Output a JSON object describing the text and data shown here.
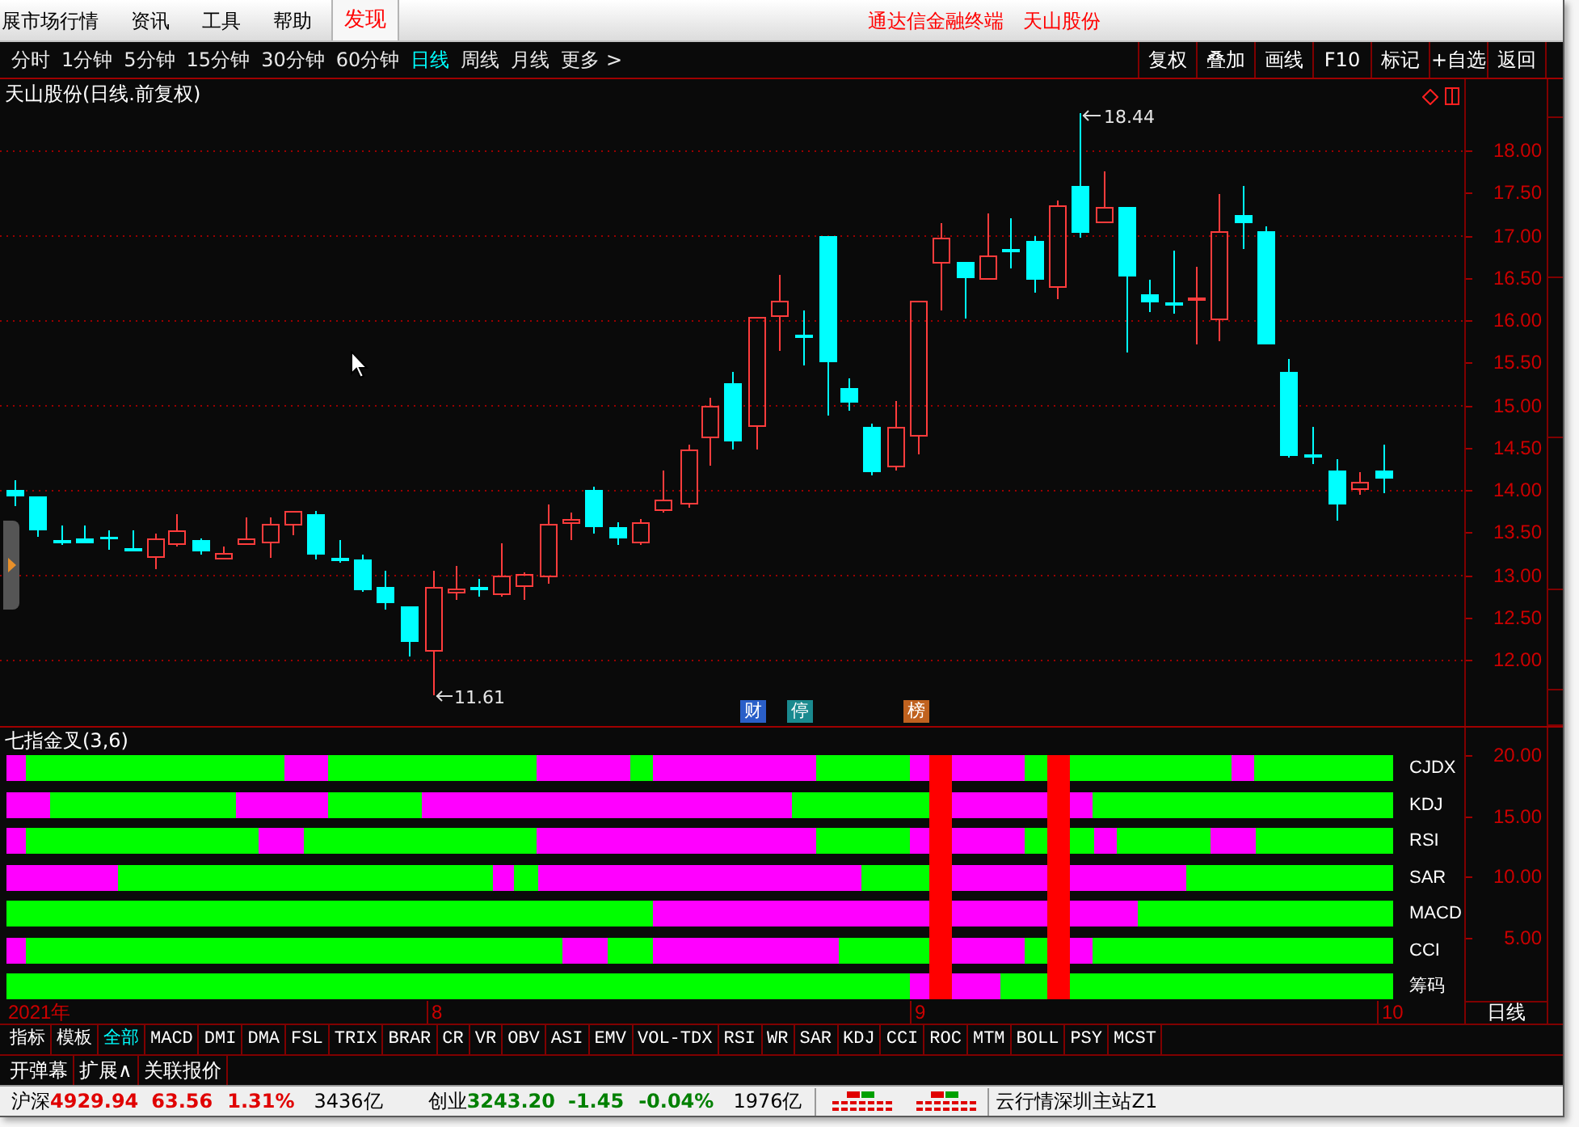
{
  "menu_bar": {
    "items": [
      {
        "label": "展市场行情",
        "selected": false
      },
      {
        "label": "资讯",
        "selected": false
      },
      {
        "label": "工具",
        "selected": false
      },
      {
        "label": "帮助",
        "selected": false
      },
      {
        "label": "发现",
        "selected": true
      }
    ],
    "app_title": "通达信金融终端",
    "stock_name": "天山股份"
  },
  "period_tabs": [
    {
      "label": "分时",
      "selected": false
    },
    {
      "label": "1分钟",
      "selected": false
    },
    {
      "label": "5分钟",
      "selected": false
    },
    {
      "label": "15分钟",
      "selected": false
    },
    {
      "label": "30分钟",
      "selected": false
    },
    {
      "label": "60分钟",
      "selected": false
    },
    {
      "label": "日线",
      "selected": true
    },
    {
      "label": "周线",
      "selected": false
    },
    {
      "label": "月线",
      "selected": false
    },
    {
      "label": "更多 >",
      "selected": false
    }
  ],
  "toolbar_buttons": [
    "复权",
    "叠加",
    "画线",
    "F10",
    "标记",
    "+自选",
    "返回"
  ],
  "chart": {
    "title": "天山股份(日线.前复权)",
    "high_label": "18.44",
    "low_label": "11.61",
    "price_axis": [
      "18.00",
      "17.50",
      "17.00",
      "16.50",
      "16.00",
      "15.50",
      "15.00",
      "14.50",
      "14.00",
      "13.50",
      "13.00",
      "12.50",
      "12.00"
    ],
    "markers": [
      {
        "label": "财",
        "color": "#2a5fc8"
      },
      {
        "label": "停",
        "color": "#1a8a8f"
      },
      {
        "label": "榜",
        "color": "#c0621f"
      }
    ]
  },
  "indicator": {
    "title": "七指金叉(3,6)",
    "rows": [
      "CJDX",
      "KDJ",
      "RSI",
      "SAR",
      "MACD",
      "CCI",
      "筹码"
    ],
    "axis": [
      "20.00",
      "15.00",
      "10.00",
      "5.00"
    ]
  },
  "date_axis": {
    "labels": [
      "2021年",
      "8",
      "9",
      "10"
    ],
    "period": "日线"
  },
  "indicator_tabs": [
    {
      "label": "指标",
      "selected": false
    },
    {
      "label": "模板",
      "selected": false
    },
    {
      "label": "全部",
      "selected": true
    },
    {
      "label": "MACD",
      "selected": false
    },
    {
      "label": "DMI",
      "selected": false
    },
    {
      "label": "DMA",
      "selected": false
    },
    {
      "label": "FSL",
      "selected": false
    },
    {
      "label": "TRIX",
      "selected": false
    },
    {
      "label": "BRAR",
      "selected": false
    },
    {
      "label": "CR",
      "selected": false
    },
    {
      "label": "VR",
      "selected": false
    },
    {
      "label": "OBV",
      "selected": false
    },
    {
      "label": "ASI",
      "selected": false
    },
    {
      "label": "EMV",
      "selected": false
    },
    {
      "label": "VOL-TDX",
      "selected": false
    },
    {
      "label": "RSI",
      "selected": false
    },
    {
      "label": "WR",
      "selected": false
    },
    {
      "label": "SAR",
      "selected": false
    },
    {
      "label": "KDJ",
      "selected": false
    },
    {
      "label": "CCI",
      "selected": false
    },
    {
      "label": "ROC",
      "selected": false
    },
    {
      "label": "MTM",
      "selected": false
    },
    {
      "label": "BOLL",
      "selected": false
    },
    {
      "label": "PSY",
      "selected": false
    },
    {
      "label": "MCST",
      "selected": false
    }
  ],
  "action_tabs": [
    "开弹幕",
    "扩展∧",
    "关联报价"
  ],
  "status_bar": {
    "indices": [
      {
        "name": "沪深",
        "value": "4929.94",
        "change": "63.56",
        "percent": "1.31%",
        "turnover": "3436亿",
        "rising": true
      },
      {
        "name": "创业",
        "value": "3243.20",
        "change": "-1.45",
        "percent": "-0.04%",
        "turnover": "1976亿",
        "rising": false
      }
    ],
    "server": "云行情深圳主站Z1"
  }
}
